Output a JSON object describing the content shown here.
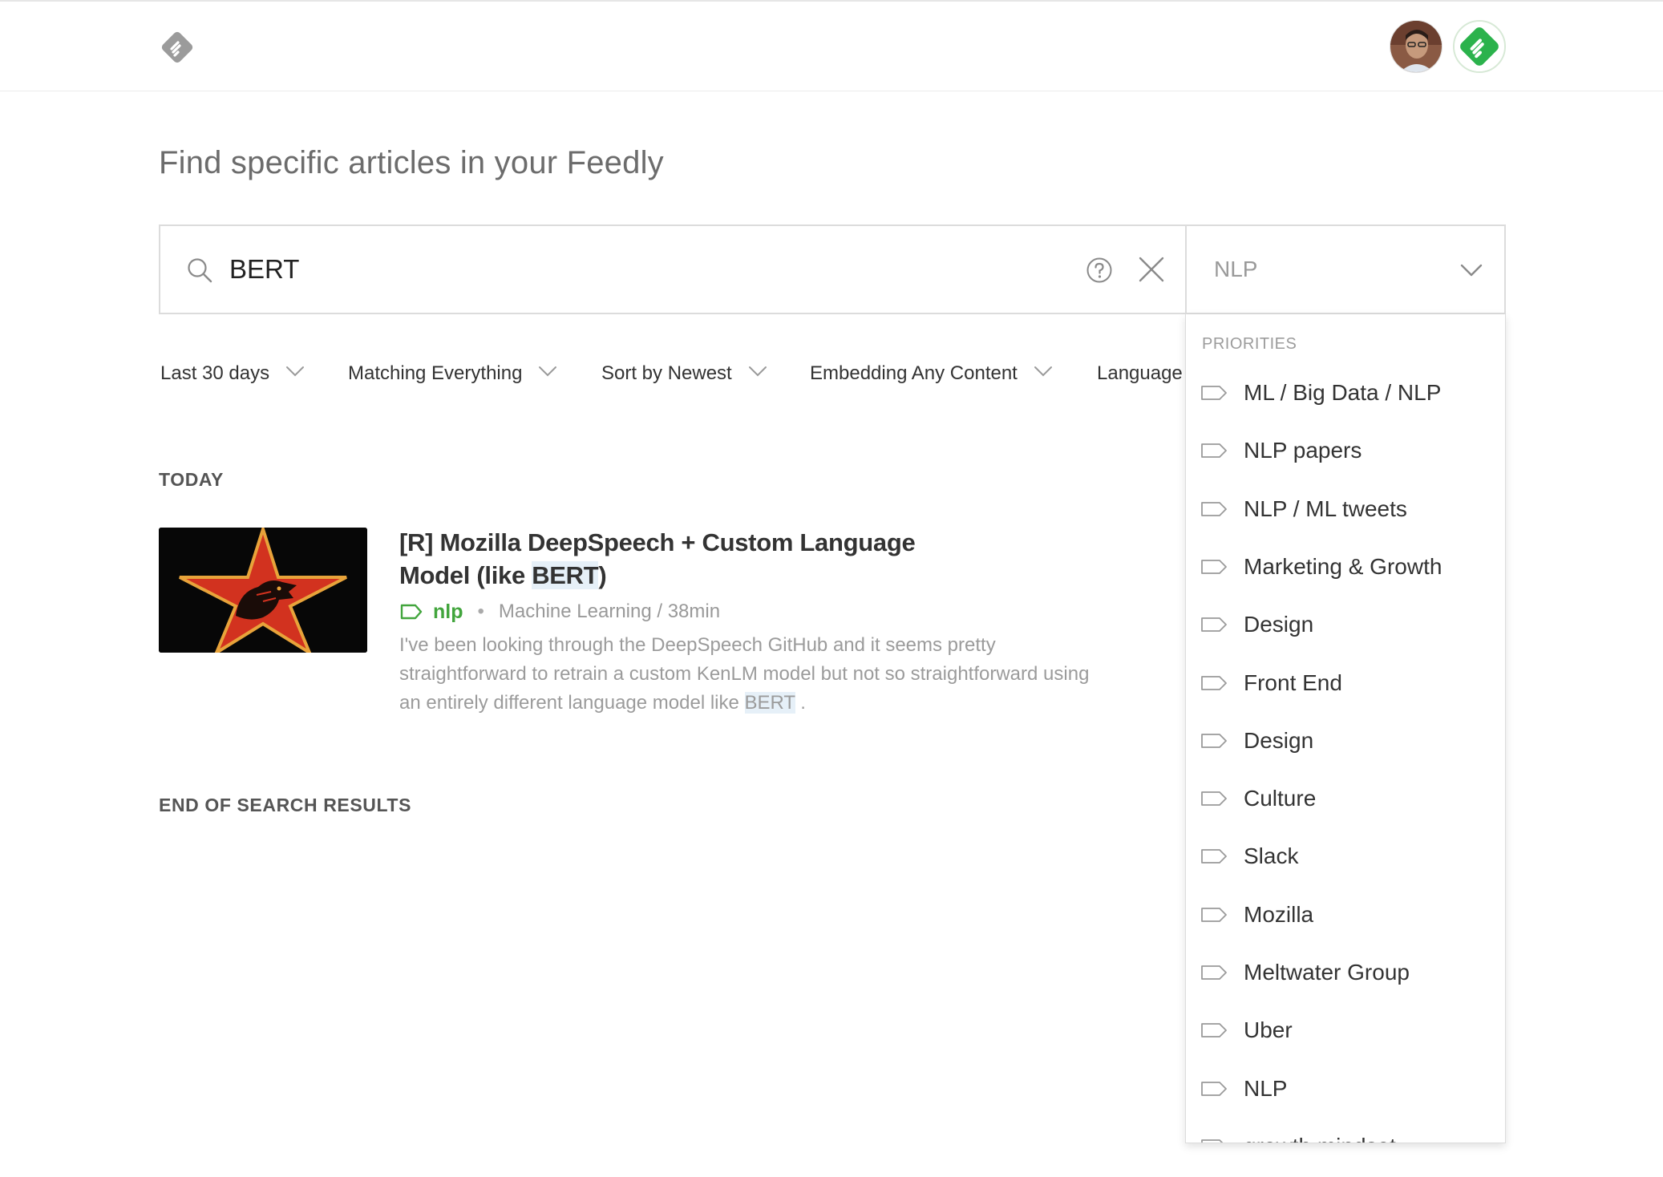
{
  "header": {
    "logo_icon": "feedly-logo-icon",
    "avatar_icon": "user-avatar",
    "feedly_avatar_icon": "feedly-avatar-icon"
  },
  "page": {
    "title": "Find specific articles in your Feedly"
  },
  "search": {
    "value": "BERT",
    "help_icon": "help-circle-icon",
    "clear_icon": "close-icon"
  },
  "feed_select": {
    "value": "NLP"
  },
  "filters": [
    {
      "label": "Last 30 days"
    },
    {
      "label": "Matching Everything"
    },
    {
      "label": "Sort by Newest"
    },
    {
      "label": "Embedding Any Content"
    },
    {
      "label": "Language"
    }
  ],
  "sections": {
    "today": "TODAY",
    "end": "END OF SEARCH RESULTS"
  },
  "article": {
    "title_part1": "[R] Mozilla DeepSpeech + Custom Language Model (like ",
    "title_highlight": "BERT",
    "title_part2": ")",
    "tag": "nlp",
    "dot": "•",
    "source": "Machine Learning / 38min",
    "summary_part1": "I've been looking through the DeepSpeech GitHub and it seems pretty straightforward to retrain a custom KenLM model but not so straightforward using an entirely different language model like ",
    "summary_highlight": "BERT",
    "summary_part2": " ."
  },
  "dropdown": {
    "header": "PRIORITIES",
    "items": [
      {
        "label": "ML / Big Data / NLP"
      },
      {
        "label": "NLP papers"
      },
      {
        "label": "NLP / ML tweets"
      },
      {
        "label": "Marketing & Growth"
      },
      {
        "label": "Design"
      },
      {
        "label": "Front End"
      },
      {
        "label": "Design"
      },
      {
        "label": "Culture"
      },
      {
        "label": "Slack"
      },
      {
        "label": "Mozilla"
      },
      {
        "label": "Meltwater Group"
      },
      {
        "label": "Uber"
      },
      {
        "label": "NLP"
      },
      {
        "label": "growth mindset"
      }
    ]
  },
  "colors": {
    "accent_green": "#42a53d",
    "highlight": "#e6f0f8",
    "border": "#dcdcdc"
  }
}
